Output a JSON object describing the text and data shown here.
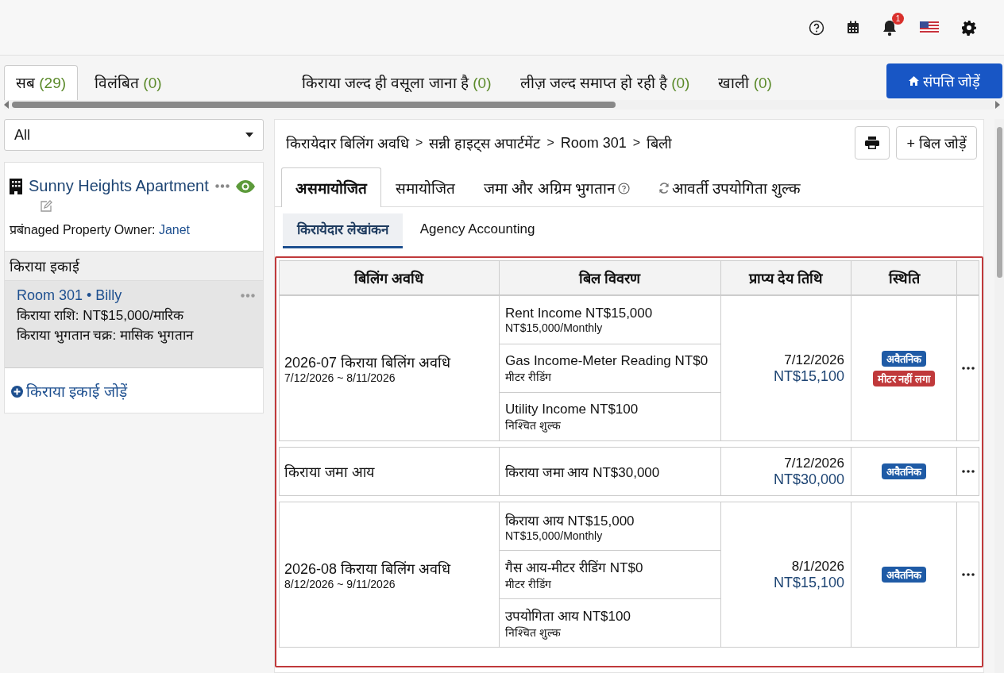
{
  "top_bar": {
    "notification_count": "1"
  },
  "tabs": [
    {
      "label": "सब",
      "count": "(29)",
      "selected": true
    },
    {
      "label": "विलंबित",
      "count": "(0)",
      "selected": false
    },
    {
      "label": "किराया जल्द ही वसूला जाना है",
      "count": "(0)",
      "selected": false
    },
    {
      "label": "लीज़ जल्द समाप्त हो रही है",
      "count": "(0)",
      "selected": false
    },
    {
      "label": "खाली",
      "count": "(0)",
      "selected": false
    }
  ],
  "add_property_button": "संपत्ति जोड़ें",
  "filter": {
    "value": "All"
  },
  "property": {
    "name": "Sunny Heights Apartment",
    "owner_label": "प्रबंnaged Property Owner:",
    "owner": "Janet"
  },
  "rental_units_heading": "किराया इकाई",
  "unit": {
    "room": "Room 301",
    "separator": "•",
    "tenant": "Billy",
    "rent": "किराया राशि: NT$15,000/मारिक",
    "cycle": "किराया भुगतान चक्र: मासिक भुगतान"
  },
  "add_unit_link": "किराया इकाई जोड़ें",
  "breadcrumb": {
    "separator": ">",
    "items": [
      "किरायेदार बिलिंग अवधि",
      "सन्नी हाइट्स अपार्टमेंट",
      "Room 301",
      "बिली"
    ]
  },
  "add_bill_button": "+ बिल जोड़ें",
  "bill_tabs": [
    {
      "label": "असमायोजित",
      "kind": "plain",
      "selected": true
    },
    {
      "label": "समायोजित",
      "kind": "plain",
      "selected": false
    },
    {
      "label": "जमा और अग्रिम भुगतान",
      "kind": "help",
      "selected": false
    },
    {
      "label": "आवर्ती उपयोगिता शुल्क",
      "kind": "recurring",
      "selected": false
    }
  ],
  "sub_tabs": [
    {
      "label": "किरायेदार लेखांकन",
      "selected": true
    },
    {
      "label": "Agency Accounting",
      "selected": false
    }
  ],
  "table": {
    "columns": [
      "बिलिंग अवधि",
      "बिल विवरण",
      "प्राप्य देय तिथि",
      "स्थिति"
    ],
    "rows": [
      {
        "period": "2026-07 किराया बिलिंग अवधि",
        "range": "7/12/2026 ~ 8/11/2026",
        "items": [
          {
            "title": "Rent Income NT$15,000",
            "note": "NT$15,000/Monthly"
          },
          {
            "title": "Gas Income-Meter Reading NT$0",
            "note": "मीटर रीडिंग"
          },
          {
            "title": "Utility Income NT$100",
            "note": "निश्चित शुल्क"
          }
        ],
        "due_date": "7/12/2026",
        "amount": "NT$15,100",
        "statuses": [
          {
            "label": "अवैतनिक",
            "color": "#1f5ba6"
          },
          {
            "label": "मीटर नहीं लगा",
            "color": "#c0393b"
          }
        ]
      },
      {
        "period": "किराया जमा आय",
        "items": [
          {
            "title": "किराया जमा आय NT$30,000"
          }
        ],
        "due_date": "7/12/2026",
        "amount": "NT$30,000",
        "statuses": [
          {
            "label": "अवैतनिक",
            "color": "#1f5ba6"
          }
        ]
      },
      {
        "period": "2026-08 किराया बिलिंग अवधि",
        "range": "8/12/2026 ~ 9/11/2026",
        "items": [
          {
            "title": "किराया आय NT$15,000",
            "note": "NT$15,000/Monthly"
          },
          {
            "title": "गैस आय-मीटर रीडिंग NT$0",
            "note": "मीटर रीडिंग"
          },
          {
            "title": "उपयोगिता आय NT$100",
            "note": "निश्चित शुल्क"
          }
        ],
        "due_date": "8/1/2026",
        "amount": "NT$15,100",
        "statuses": [
          {
            "label": "अवैतनिक",
            "color": "#1f5ba6"
          }
        ]
      }
    ]
  }
}
